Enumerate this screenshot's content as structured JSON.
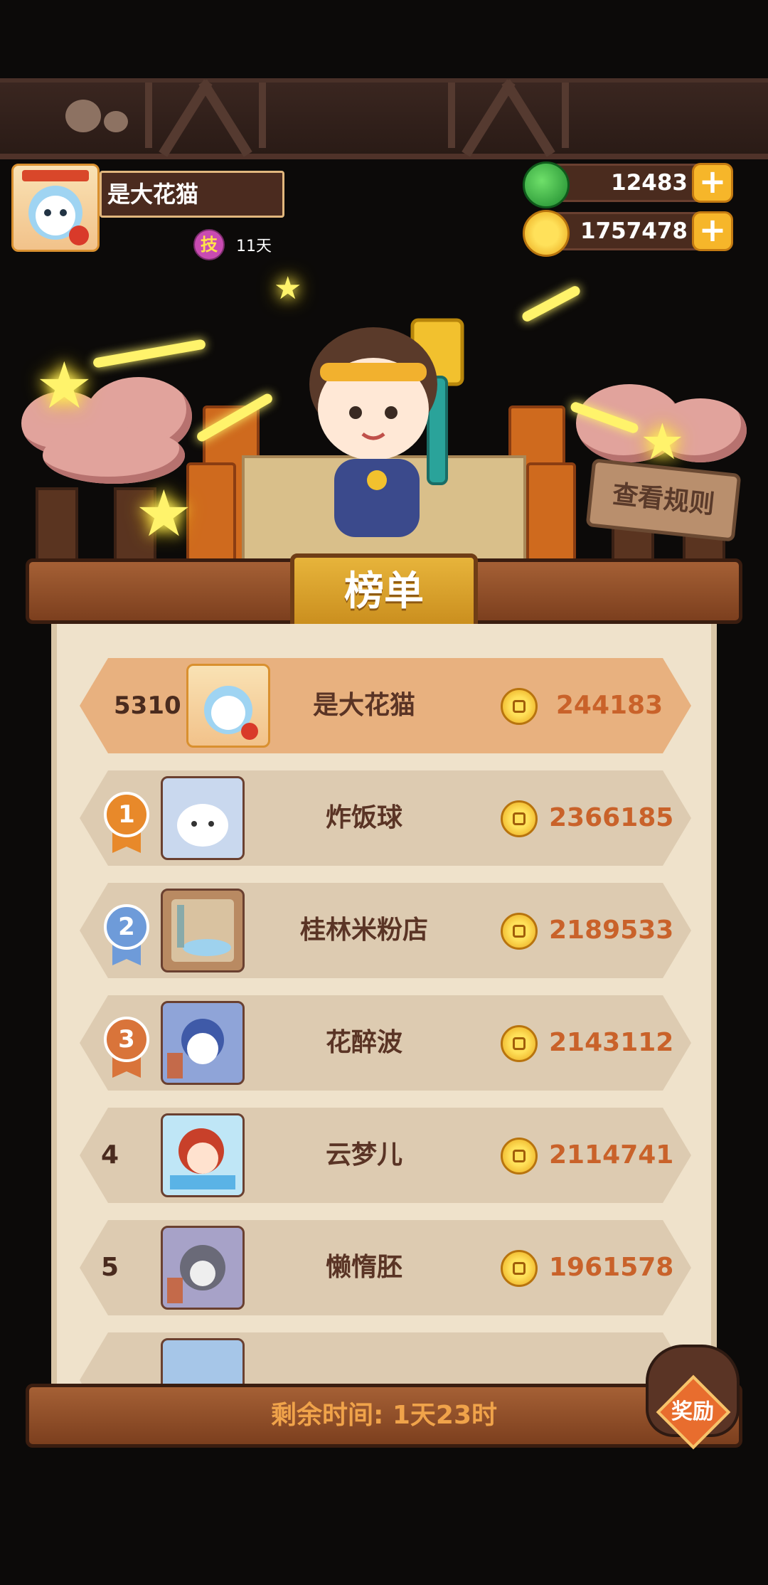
{
  "profile": {
    "name": "是大花猫",
    "skill_badge": "技",
    "days": "11天"
  },
  "resources": {
    "gems": "12483",
    "coins": "1757478",
    "plus": "+"
  },
  "rules_button": "查看规则",
  "title": "榜单",
  "my_entry": {
    "rank": "5310",
    "name": "是大花猫",
    "score": "244183"
  },
  "leaderboard": [
    {
      "rank": "1",
      "name": "炸饭球",
      "score": "2366185",
      "medal_color": "#e8892a"
    },
    {
      "rank": "2",
      "name": "桂林米粉店",
      "score": "2189533",
      "medal_color": "#6e9bd9"
    },
    {
      "rank": "3",
      "name": "花醉波",
      "score": "2143112",
      "medal_color": "#d9743a"
    },
    {
      "rank": "4",
      "name": "云梦儿",
      "score": "2114741"
    },
    {
      "rank": "5",
      "name": "懒惰胚",
      "score": "1961578"
    }
  ],
  "remaining_time": "剩余时间: 1天23时",
  "reward": "奖励"
}
